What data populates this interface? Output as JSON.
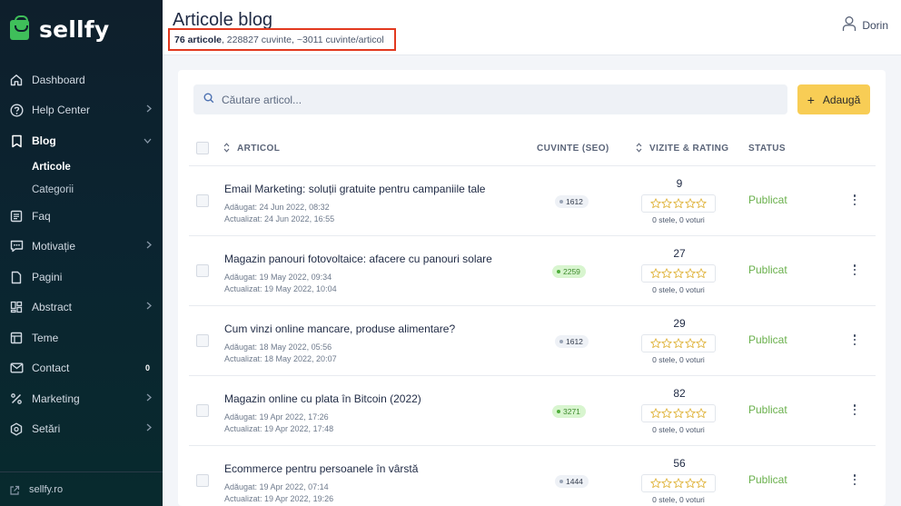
{
  "app": {
    "brand": "sellfy"
  },
  "sidebar": {
    "items": [
      {
        "label": "Dashboard"
      },
      {
        "label": "Help Center"
      },
      {
        "label": "Blog"
      },
      {
        "label": "Faq"
      },
      {
        "label": "Motivație"
      },
      {
        "label": "Pagini"
      },
      {
        "label": "Abstract"
      },
      {
        "label": "Teme"
      },
      {
        "label": "Contact",
        "count": "0"
      },
      {
        "label": "Marketing"
      },
      {
        "label": "Setări"
      }
    ],
    "blog_sub": [
      {
        "label": "Articole"
      },
      {
        "label": "Categorii"
      }
    ],
    "footer_url": "sellfy.ro"
  },
  "header": {
    "title": "Articole blog",
    "stats_bold": "76 articole",
    "stats_rest": ", 228827 cuvinte, ~3011 cuvinte/articol",
    "user_name": "Dorin"
  },
  "search": {
    "placeholder": "Căutare articol..."
  },
  "add_button": {
    "label": "Adaugă",
    "icon": "plus-icon"
  },
  "table": {
    "columns": {
      "article": "ARTICOL",
      "words": "CUVINTE (SEO)",
      "visits": "VIZITE & RATING",
      "status": "STATUS"
    },
    "rows": [
      {
        "title": "Email Marketing: soluții gratuite pentru campaniile tale",
        "added": "Adăugat: 24 Jun 2022, 08:32",
        "updated": "Actualizat: 24 Jun 2022, 16:55",
        "words": "1612",
        "words_good": false,
        "visits": "9",
        "rating": "0 stele, 0 voturi",
        "stars": 0,
        "status": "Publicat"
      },
      {
        "title": "Magazin panouri fotovoltaice: afacere cu panouri solare",
        "added": "Adăugat: 19 May 2022, 09:34",
        "updated": "Actualizat: 19 May 2022, 10:04",
        "words": "2259",
        "words_good": true,
        "visits": "27",
        "rating": "0 stele, 0 voturi",
        "stars": 0,
        "status": "Publicat"
      },
      {
        "title": "Cum vinzi online mancare, produse alimentare?",
        "added": "Adăugat: 18 May 2022, 05:56",
        "updated": "Actualizat: 18 May 2022, 20:07",
        "words": "1612",
        "words_good": false,
        "visits": "29",
        "rating": "0 stele, 0 voturi",
        "stars": 0,
        "status": "Publicat"
      },
      {
        "title": "Magazin online cu plata în Bitcoin (2022)",
        "added": "Adăugat: 19 Apr 2022, 17:26",
        "updated": "Actualizat: 19 Apr 2022, 17:48",
        "words": "3271",
        "words_good": true,
        "visits": "82",
        "rating": "0 stele, 0 voturi",
        "stars": 0,
        "status": "Publicat"
      },
      {
        "title": "Ecommerce pentru persoanele în vârstă",
        "added": "Adăugat: 19 Apr 2022, 07:14",
        "updated": "Actualizat: 19 Apr 2022, 19:26",
        "words": "1444",
        "words_good": false,
        "visits": "56",
        "rating": "0 stele, 0 voturi",
        "stars": 0,
        "status": "Publicat"
      }
    ]
  },
  "colors": {
    "sidebar_bg": "#0e1f2c",
    "brand_green": "#3fbf5a",
    "accent_yellow": "#f8cd55",
    "status_green": "#6ab04c",
    "highlight_red": "#e2391f"
  }
}
